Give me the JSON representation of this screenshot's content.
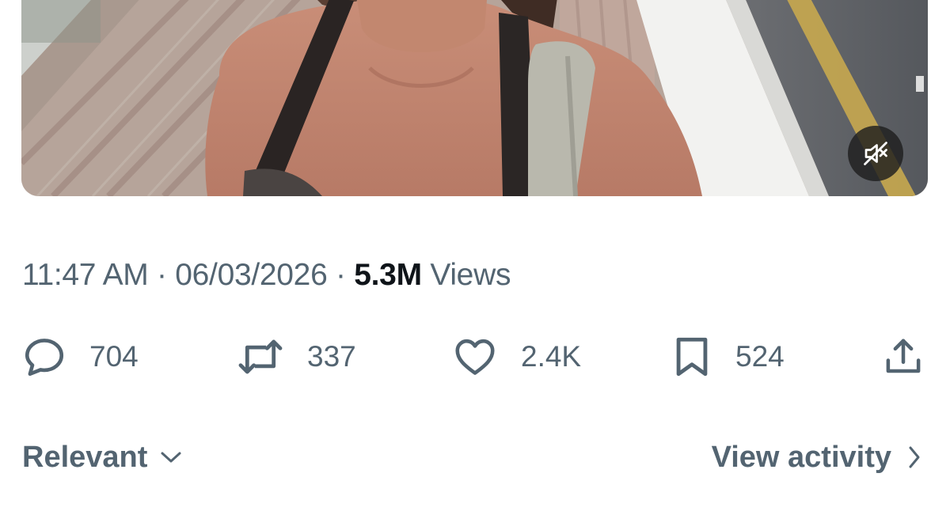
{
  "tweet": {
    "time": "11:47 AM",
    "date": "06/03/2026",
    "separator": "·",
    "views_count": "5.3M",
    "views_label": "Views"
  },
  "video": {
    "mute_icon": "speaker-muted-icon"
  },
  "actions": {
    "reply": {
      "icon": "reply-bubble-icon",
      "count": "704"
    },
    "repost": {
      "icon": "repost-icon",
      "count": "337"
    },
    "like": {
      "icon": "heart-icon",
      "count": "2.4K"
    },
    "bookmark": {
      "icon": "bookmark-icon",
      "count": "524"
    },
    "share": {
      "icon": "share-icon"
    }
  },
  "footer": {
    "sort_label": "Relevant",
    "sort_icon": "chevron-down-icon",
    "activity_label": "View activity",
    "activity_icon": "chevron-right-icon"
  },
  "colors": {
    "muted_text": "#536471",
    "primary_text": "#0f1419",
    "background": "#ffffff"
  }
}
